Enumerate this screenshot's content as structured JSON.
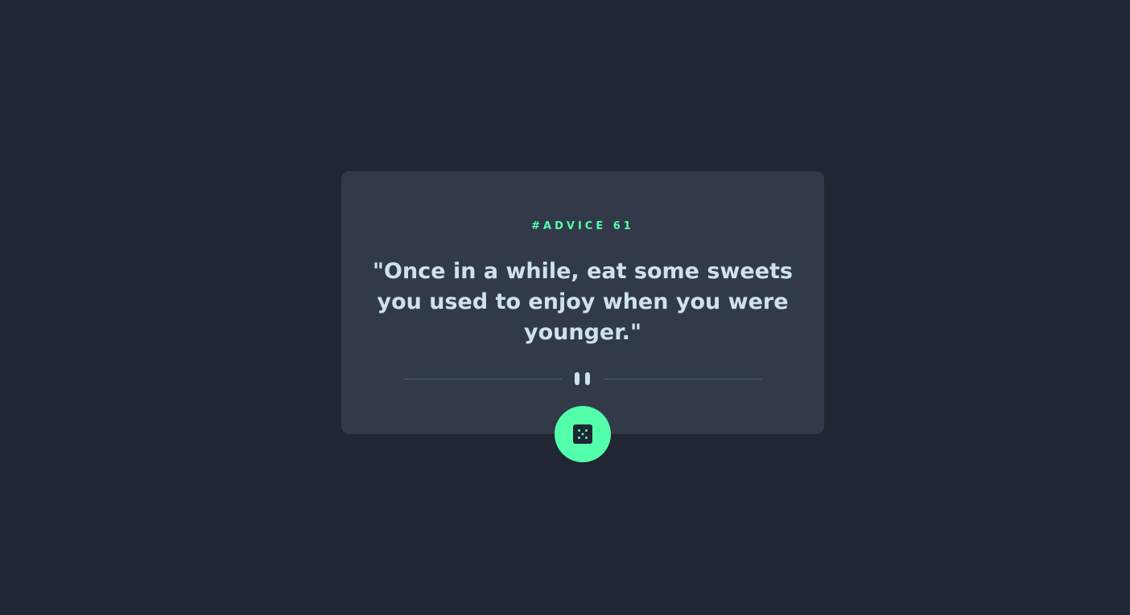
{
  "card": {
    "advice_label": "#ADVICE 61",
    "quote": "\"Once in a while, eat some sweets you used to enjoy when you were younger.\""
  },
  "divider": {
    "icon": "pause-icon"
  },
  "button": {
    "icon": "dice-icon"
  },
  "colors": {
    "background": "#202632",
    "card": "#323A49",
    "accent": "#53FFAA",
    "text": "#CEE3E9",
    "divider": "#4F5D74"
  }
}
